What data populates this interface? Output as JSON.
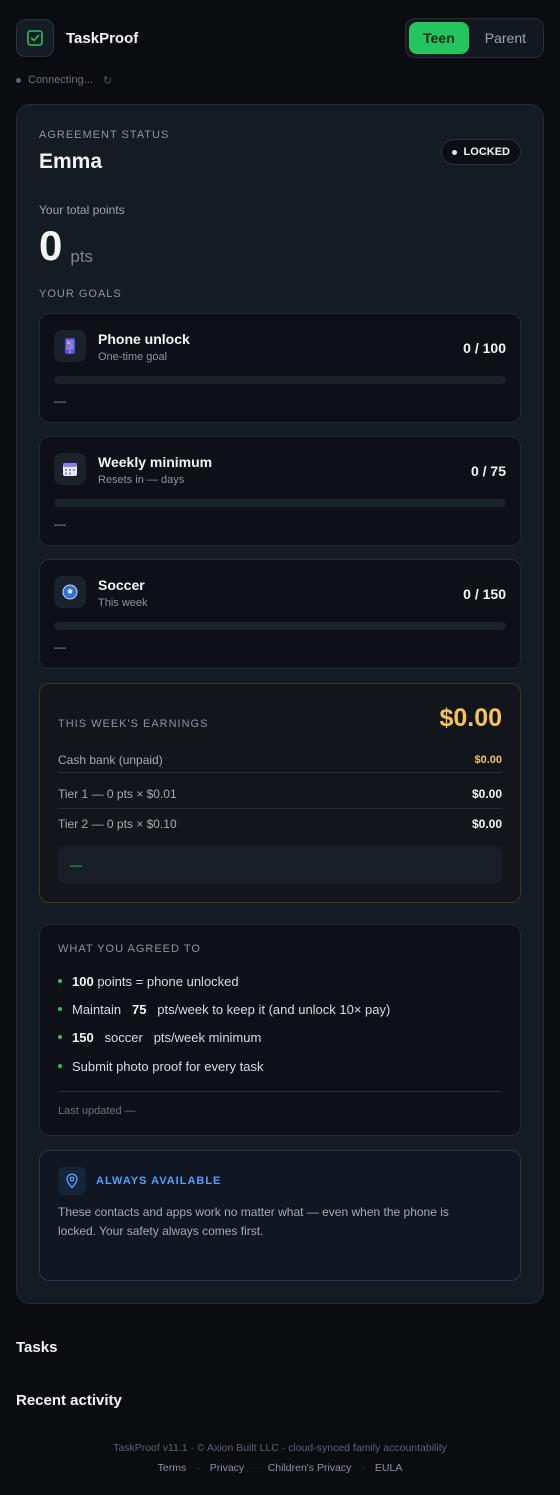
{
  "header": {
    "app_name": "TaskProof",
    "roles": [
      "Teen",
      "Parent"
    ],
    "active_role": "Teen"
  },
  "connection": {
    "status": "Connecting..."
  },
  "status_card": {
    "eyebrow": "AGREEMENT STATUS",
    "child_name": "Emma",
    "lock_status": "LOCKED",
    "points_label": "Your total points",
    "points": "0",
    "points_unit": "pts",
    "goals_heading": "YOUR GOALS"
  },
  "goals": [
    {
      "title": "Phone unlock",
      "subtitle": "One-time goal",
      "progress_text": "0 / 100",
      "progress": 0,
      "footnote": "—",
      "icon": "phone-icon"
    },
    {
      "title": "Weekly minimum",
      "subtitle": "Resets in — days",
      "progress_text": "0 / 75",
      "progress": 0,
      "footnote": "—",
      "icon": "calendar-icon"
    },
    {
      "title": "Soccer",
      "subtitle": "This week",
      "progress_text": "0 / 150",
      "progress": 0,
      "footnote": "—",
      "icon": "soccer-ball-icon"
    }
  ],
  "earnings": {
    "heading": "THIS WEEK'S EARNINGS",
    "total": "$0.00",
    "rows": [
      {
        "label": "Cash bank (unpaid)",
        "value": "$0.00"
      },
      {
        "label": "Tier 1 — 0 pts × $0.01",
        "value": "$0.00"
      },
      {
        "label": "Tier 2 — 0 pts × $0.10",
        "value": "$0.00"
      }
    ],
    "note": "—"
  },
  "agreement": {
    "heading": "WHAT YOU AGREED TO",
    "items": [
      {
        "strong": "100",
        "text": "points = phone unlocked"
      },
      {
        "pre": "Maintain",
        "strong": "75",
        "text": "pts/week to keep it (and unlock 10× pay)"
      },
      {
        "strong": "150",
        "mid": "soccer",
        "text": "pts/week minimum"
      },
      {
        "text": "Submit photo proof for every task"
      }
    ],
    "last_updated": "Last updated —"
  },
  "always_available": {
    "title": "ALWAYS AVAILABLE",
    "text": "These contacts and apps work no matter what — even when the phone is locked. Your safety always comes first."
  },
  "sections": {
    "tasks": "Tasks",
    "recent_activity": "Recent activity"
  },
  "footer": {
    "line": "TaskProof v11.1 · © Axion Built LLC · cloud-synced family accountability",
    "links": [
      "Terms",
      "Privacy",
      "Children's Privacy",
      "EULA"
    ]
  },
  "colors": {
    "accent": "#22c55e",
    "gold": "#f5c451",
    "info": "#4ea0ff",
    "background": "#0a0c10"
  }
}
